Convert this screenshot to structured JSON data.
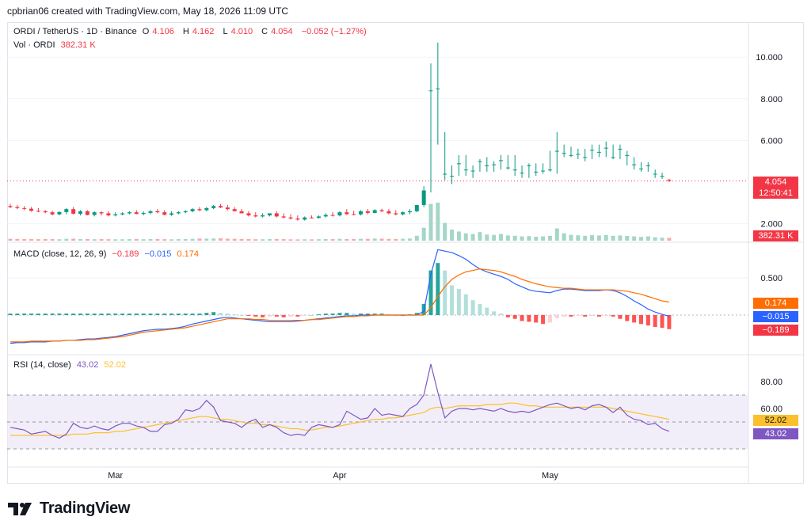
{
  "header": {
    "credit": "cpbrian06 created with TradingView.com, May 18, 2026 11:09 UTC"
  },
  "legend": {
    "symbol": "ORDI / TetherUS · 1D · Binance",
    "o_label": "O",
    "o_value": "4.106",
    "h_label": "H",
    "h_value": "4.162",
    "l_label": "L",
    "l_value": "4.010",
    "c_label": "C",
    "c_value": "4.054",
    "change": "−0.052 (−1.27%)",
    "vol_label": "Vol · ORDI",
    "vol_value": "382.31 K",
    "macd_label": "MACD (close, 12, 26, 9)",
    "macd_hist": "−0.189",
    "macd_line": "−0.015",
    "macd_signal": "0.174",
    "rsi_label": "RSI (14, close)",
    "rsi_value": "43.02",
    "rsi_ma": "52.02"
  },
  "badges": {
    "price": "4.054",
    "countdown": "12:50:41",
    "volume": "382.31 K",
    "macd_signal": "0.174",
    "macd_line": "−0.015",
    "macd_hist": "−0.189",
    "rsi_ma": "52.02",
    "rsi": "43.02"
  },
  "colors": {
    "up": "#089981",
    "down": "#f23645",
    "up_light": "#a5d6c8",
    "down_light": "#f7a9a7",
    "macd": "#2962ff",
    "signal": "#ff6d00",
    "rsi": "#7e57c2",
    "rsi_ma": "#fbc02d",
    "rsi_band": "#ede7f6"
  },
  "brand": {
    "name": "TradingView"
  },
  "chart_data": {
    "type": "candlestick",
    "price_axis": {
      "ticks": [
        2.0,
        6.0,
        8.0,
        10.0
      ],
      "tick_labels": [
        "2.000",
        "6.000",
        "8.000",
        "10.000"
      ]
    },
    "x_axis": {
      "labels": [
        "Mar",
        "Apr",
        "May"
      ],
      "label_day_index": [
        15,
        47,
        77
      ]
    },
    "macd_axis": {
      "ticks": [
        0.5
      ],
      "tick_labels": [
        "0.500"
      ]
    },
    "rsi_axis": {
      "ticks": [
        80,
        60
      ],
      "tick_labels": [
        "80.00",
        "60.00"
      ],
      "bands": [
        70,
        50,
        30
      ]
    },
    "price": {
      "open": [
        2.85,
        2.8,
        2.75,
        2.72,
        2.62,
        2.6,
        2.55,
        2.45,
        2.56,
        2.7,
        2.48,
        2.6,
        2.42,
        2.55,
        2.5,
        2.4,
        2.45,
        2.5,
        2.55,
        2.47,
        2.52,
        2.6,
        2.55,
        2.43,
        2.5,
        2.55,
        2.6,
        2.7,
        2.65,
        2.75,
        2.85,
        2.78,
        2.7,
        2.6,
        2.5,
        2.4,
        2.35,
        2.4,
        2.5,
        2.35,
        2.3,
        2.25,
        2.2,
        2.3,
        2.28,
        2.35,
        2.42,
        2.4,
        2.55,
        2.46,
        2.45,
        2.6,
        2.52,
        2.65,
        2.6,
        2.5,
        2.45,
        2.55,
        2.6,
        2.9,
        8.4,
        8.5,
        4.4,
        4.3,
        4.9,
        4.6,
        4.55,
        5.0,
        4.8,
        4.85,
        5.05,
        4.7,
        4.6,
        4.45,
        4.8,
        4.5,
        4.55,
        4.6,
        5.5,
        5.4,
        5.3,
        5.35,
        5.2,
        5.55,
        5.45,
        5.65,
        5.2,
        5.6,
        5.3,
        4.85,
        4.65,
        4.8,
        4.4,
        4.3,
        4.106
      ],
      "high": [
        2.95,
        2.9,
        2.85,
        2.8,
        2.75,
        2.65,
        2.62,
        2.6,
        2.75,
        2.8,
        2.65,
        2.65,
        2.6,
        2.6,
        2.6,
        2.55,
        2.55,
        2.6,
        2.65,
        2.6,
        2.65,
        2.7,
        2.65,
        2.6,
        2.6,
        2.65,
        2.75,
        2.8,
        2.8,
        2.9,
        2.95,
        2.9,
        2.8,
        2.7,
        2.6,
        2.55,
        2.5,
        2.5,
        2.6,
        2.5,
        2.45,
        2.4,
        2.35,
        2.4,
        2.4,
        2.5,
        2.55,
        2.6,
        2.7,
        2.62,
        2.65,
        2.7,
        2.7,
        2.72,
        2.7,
        2.65,
        2.6,
        2.7,
        2.9,
        3.8,
        9.7,
        10.7,
        6.4,
        4.8,
        5.3,
        5.3,
        4.8,
        5.1,
        5.2,
        5.0,
        5.3,
        5.3,
        5.3,
        4.8,
        4.9,
        4.9,
        4.9,
        5.5,
        6.4,
        5.8,
        5.7,
        5.6,
        5.6,
        5.8,
        5.8,
        5.95,
        5.8,
        5.8,
        5.5,
        5.2,
        4.95,
        4.95,
        4.6,
        4.45,
        4.162
      ],
      "low": [
        2.75,
        2.7,
        2.65,
        2.58,
        2.55,
        2.5,
        2.4,
        2.4,
        2.45,
        2.45,
        2.4,
        2.4,
        2.35,
        2.4,
        2.35,
        2.35,
        2.4,
        2.45,
        2.45,
        2.4,
        2.45,
        2.5,
        2.4,
        2.38,
        2.45,
        2.5,
        2.55,
        2.6,
        2.6,
        2.7,
        2.75,
        2.65,
        2.6,
        2.5,
        2.35,
        2.3,
        2.3,
        2.35,
        2.3,
        2.25,
        2.2,
        2.15,
        2.15,
        2.25,
        2.25,
        2.3,
        2.35,
        2.35,
        2.42,
        2.4,
        2.4,
        2.45,
        2.5,
        2.55,
        2.45,
        2.4,
        2.4,
        2.45,
        2.55,
        2.8,
        3.5,
        5.8,
        4.1,
        3.9,
        4.3,
        4.3,
        4.2,
        4.5,
        4.5,
        4.5,
        4.6,
        4.6,
        4.3,
        4.2,
        4.2,
        4.3,
        4.4,
        4.5,
        4.4,
        5.2,
        5.2,
        5.1,
        5.0,
        5.1,
        5.2,
        5.2,
        5.1,
        5.1,
        4.8,
        4.6,
        4.5,
        4.5,
        4.2,
        4.15,
        4.01
      ],
      "close": [
        2.8,
        2.75,
        2.72,
        2.62,
        2.6,
        2.55,
        2.45,
        2.56,
        2.7,
        2.48,
        2.6,
        2.42,
        2.55,
        2.5,
        2.4,
        2.45,
        2.5,
        2.55,
        2.47,
        2.52,
        2.6,
        2.55,
        2.43,
        2.5,
        2.55,
        2.6,
        2.7,
        2.65,
        2.75,
        2.85,
        2.78,
        2.7,
        2.6,
        2.5,
        2.4,
        2.35,
        2.4,
        2.5,
        2.35,
        2.3,
        2.25,
        2.2,
        2.3,
        2.28,
        2.35,
        2.42,
        2.4,
        2.55,
        2.46,
        2.45,
        2.6,
        2.52,
        2.65,
        2.6,
        2.5,
        2.45,
        2.55,
        2.6,
        2.9,
        3.6,
        8.4,
        8.5,
        4.4,
        4.3,
        4.9,
        4.6,
        4.55,
        5.0,
        4.8,
        4.85,
        5.05,
        4.7,
        4.6,
        4.45,
        4.8,
        4.5,
        4.55,
        4.6,
        5.5,
        5.4,
        5.3,
        5.35,
        5.2,
        5.55,
        5.45,
        5.65,
        5.2,
        5.6,
        5.3,
        4.85,
        4.65,
        4.8,
        4.4,
        4.3,
        4.054
      ],
      "last_price": 4.054
    },
    "volume": {
      "values": [
        30,
        28,
        25,
        27,
        24,
        26,
        25,
        23,
        30,
        32,
        26,
        27,
        24,
        25,
        24,
        22,
        23,
        25,
        28,
        24,
        26,
        27,
        24,
        22,
        25,
        26,
        30,
        35,
        33,
        36,
        38,
        32,
        30,
        28,
        26,
        24,
        23,
        26,
        28,
        25,
        22,
        21,
        23,
        22,
        24,
        26,
        25,
        30,
        27,
        26,
        31,
        29,
        34,
        33,
        29,
        28,
        31,
        35,
        80,
        210,
        600,
        620,
        290,
        180,
        150,
        120,
        110,
        140,
        100,
        95,
        110,
        85,
        80,
        70,
        75,
        65,
        70,
        78,
        200,
        120,
        95,
        88,
        80,
        90,
        85,
        92,
        80,
        85,
        78,
        70,
        62,
        70,
        55,
        48,
        45
      ],
      "last": 382.31
    },
    "macd": {
      "hist": [
        0.02,
        0.02,
        0.02,
        0.02,
        0.02,
        0.02,
        0.02,
        0.02,
        0.02,
        0.02,
        0.02,
        0.02,
        0.02,
        0.02,
        0.02,
        0.02,
        0.02,
        0.02,
        0.02,
        0.02,
        0.02,
        0.02,
        0.02,
        0.02,
        0.02,
        0.02,
        0.02,
        0.02,
        0.03,
        0.04,
        0.03,
        0.02,
        0.01,
        0.0,
        -0.01,
        -0.02,
        -0.03,
        -0.02,
        -0.02,
        -0.03,
        -0.02,
        -0.02,
        -0.01,
        0.0,
        0.01,
        0.02,
        0.02,
        0.03,
        0.03,
        0.02,
        0.02,
        0.02,
        0.02,
        0.02,
        0.01,
        0.0,
        0.0,
        0.01,
        0.03,
        0.15,
        0.6,
        0.7,
        0.6,
        0.4,
        0.35,
        0.28,
        0.2,
        0.15,
        0.1,
        0.05,
        0.02,
        -0.03,
        -0.05,
        -0.08,
        -0.09,
        -0.1,
        -0.12,
        -0.1,
        -0.04,
        -0.02,
        -0.02,
        -0.01,
        -0.02,
        -0.01,
        -0.02,
        -0.01,
        -0.02,
        -0.05,
        -0.08,
        -0.1,
        -0.12,
        -0.14,
        -0.16,
        -0.17,
        -0.189
      ],
      "line": [
        -0.38,
        -0.37,
        -0.37,
        -0.36,
        -0.36,
        -0.36,
        -0.35,
        -0.35,
        -0.34,
        -0.34,
        -0.33,
        -0.32,
        -0.32,
        -0.31,
        -0.3,
        -0.29,
        -0.27,
        -0.25,
        -0.23,
        -0.21,
        -0.2,
        -0.19,
        -0.19,
        -0.18,
        -0.17,
        -0.15,
        -0.12,
        -0.1,
        -0.08,
        -0.06,
        -0.04,
        -0.03,
        -0.04,
        -0.05,
        -0.06,
        -0.07,
        -0.08,
        -0.09,
        -0.09,
        -0.09,
        -0.09,
        -0.08,
        -0.07,
        -0.06,
        -0.05,
        -0.04,
        -0.03,
        -0.02,
        -0.01,
        -0.01,
        0.0,
        0.0,
        0.0,
        0.0,
        0.0,
        0.0,
        0.0,
        0.0,
        0.0,
        0.05,
        0.55,
        0.88,
        0.86,
        0.84,
        0.8,
        0.75,
        0.68,
        0.62,
        0.58,
        0.55,
        0.52,
        0.48,
        0.42,
        0.38,
        0.34,
        0.32,
        0.31,
        0.3,
        0.33,
        0.35,
        0.35,
        0.34,
        0.33,
        0.33,
        0.33,
        0.34,
        0.33,
        0.3,
        0.25,
        0.19,
        0.14,
        0.08,
        0.04,
        0.01,
        -0.015
      ],
      "signal": [
        -0.36,
        -0.36,
        -0.36,
        -0.35,
        -0.35,
        -0.35,
        -0.35,
        -0.35,
        -0.34,
        -0.34,
        -0.34,
        -0.33,
        -0.33,
        -0.32,
        -0.31,
        -0.3,
        -0.29,
        -0.27,
        -0.25,
        -0.23,
        -0.22,
        -0.21,
        -0.2,
        -0.19,
        -0.18,
        -0.17,
        -0.15,
        -0.13,
        -0.11,
        -0.09,
        -0.07,
        -0.05,
        -0.05,
        -0.05,
        -0.05,
        -0.06,
        -0.06,
        -0.07,
        -0.07,
        -0.07,
        -0.07,
        -0.07,
        -0.07,
        -0.06,
        -0.06,
        -0.05,
        -0.04,
        -0.03,
        -0.02,
        -0.02,
        -0.01,
        -0.01,
        0.0,
        0.0,
        0.0,
        0.0,
        0.0,
        0.0,
        0.0,
        0.0,
        0.1,
        0.25,
        0.38,
        0.48,
        0.54,
        0.58,
        0.6,
        0.62,
        0.61,
        0.6,
        0.58,
        0.55,
        0.52,
        0.48,
        0.45,
        0.42,
        0.4,
        0.38,
        0.37,
        0.36,
        0.36,
        0.35,
        0.34,
        0.34,
        0.34,
        0.34,
        0.34,
        0.33,
        0.32,
        0.3,
        0.28,
        0.25,
        0.22,
        0.19,
        0.174
      ],
      "zero_line": 0
    },
    "rsi": {
      "rsi": [
        46,
        45,
        44,
        41,
        42,
        43,
        40,
        38,
        41,
        49,
        46,
        45,
        47,
        45,
        44,
        47,
        49,
        49,
        47,
        46,
        43,
        43,
        48,
        49,
        52,
        59,
        58,
        60,
        66,
        61,
        51,
        50,
        49,
        46,
        50,
        52,
        46,
        48,
        46,
        42,
        40,
        41,
        40,
        46,
        48,
        47,
        46,
        48,
        58,
        55,
        52,
        53,
        60,
        55,
        56,
        55,
        54,
        60,
        63,
        70,
        93,
        72,
        53,
        58,
        60,
        60,
        59,
        60,
        59,
        58,
        60,
        58,
        57,
        58,
        57,
        59,
        61,
        63,
        64,
        62,
        60,
        61,
        59,
        62,
        63,
        61,
        57,
        61,
        55,
        52,
        51,
        48,
        49,
        45,
        43.02
      ],
      "rsi_ma": [
        40,
        40,
        40,
        40,
        40,
        40,
        40,
        40,
        40,
        41,
        41,
        41,
        42,
        42,
        42,
        43,
        43,
        44,
        45,
        46,
        47,
        48,
        49,
        50,
        51,
        52,
        53,
        54,
        54,
        53,
        52,
        52,
        51,
        50,
        49,
        49,
        48,
        48,
        47,
        46,
        45,
        45,
        44,
        44,
        45,
        46,
        46,
        47,
        48,
        49,
        50,
        51,
        52,
        52,
        53,
        53,
        54,
        55,
        56,
        57,
        60,
        61,
        60,
        61,
        62,
        62,
        62,
        62,
        63,
        63,
        63,
        64,
        64,
        63,
        62,
        62,
        61,
        61,
        61,
        61,
        61,
        61,
        61,
        61,
        61,
        61,
        60,
        59,
        58,
        57,
        56,
        55,
        54,
        53,
        52.02
      ]
    }
  }
}
